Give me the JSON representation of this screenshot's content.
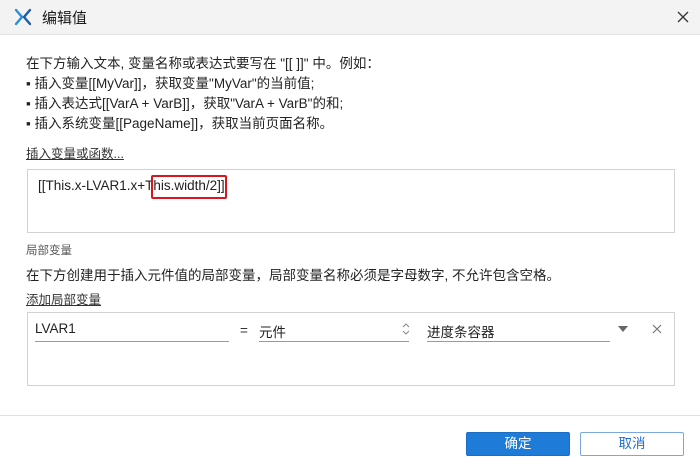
{
  "window": {
    "title": "编辑值",
    "app_icon": "x-logo-icon",
    "close_icon": "close-icon"
  },
  "description": {
    "line1": "在下方输入文本, 变量名称或表达式要写在 \"[[ ]]\" 中。例如：",
    "line2": "▪ 插入变量[[MyVar]]，获取变量\"MyVar\"的当前值;",
    "line3": "▪ 插入表达式[[VarA + VarB]]，获取\"VarA + VarB\"的和;",
    "line4": "▪ 插入系统变量[[PageName]]，获取当前页面名称。"
  },
  "insert_link": "插入变量或函数...",
  "expression": {
    "part1": "[[This.x-LVAR1.x+",
    "part2": "This.width/2]]"
  },
  "local_vars": {
    "section_label": "局部变量",
    "description": "在下方创建用于插入元件值的局部变量，局部变量名称必须是字母数字, 不允许包含空格。",
    "add_link": "添加局部变量",
    "rows": [
      {
        "name": "LVAR1",
        "equals": "=",
        "type": "元件",
        "target": "进度条容器"
      }
    ]
  },
  "buttons": {
    "ok": "确定",
    "cancel": "取消"
  },
  "colors": {
    "primary": "#1e7bd8",
    "highlight_border": "#d9161c"
  }
}
